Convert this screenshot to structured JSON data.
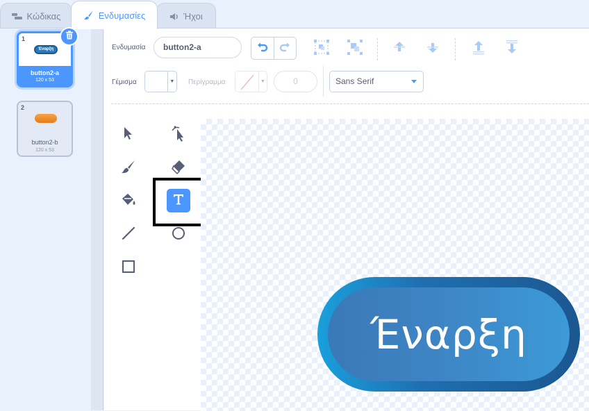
{
  "tabs": [
    {
      "label": "Κώδικας",
      "icon": "code-icon"
    },
    {
      "label": "Ενδυμασίες",
      "icon": "brush-icon",
      "active": true
    },
    {
      "label": "Ήχοι",
      "icon": "speaker-icon"
    }
  ],
  "costumes": [
    {
      "number": "1",
      "name": "button2-a",
      "size": "120 x 53",
      "selected": true,
      "thumb_text": "Έναρξη"
    },
    {
      "number": "2",
      "name": "button2-b",
      "size": "120 x 53",
      "selected": false
    }
  ],
  "toolbar": {
    "costume_label": "Ενδυμασία",
    "costume_name": "button2-a",
    "fill_label": "Γέμισμα",
    "outline_label": "Περίγραμμα",
    "outline_width": "0",
    "font": "Sans Serif"
  },
  "canvas": {
    "button_text": "Έναρξη"
  },
  "colors": {
    "accent": "#4c97ff",
    "button_outer": "#1b5791",
    "button_inner": "#3e84c4"
  }
}
